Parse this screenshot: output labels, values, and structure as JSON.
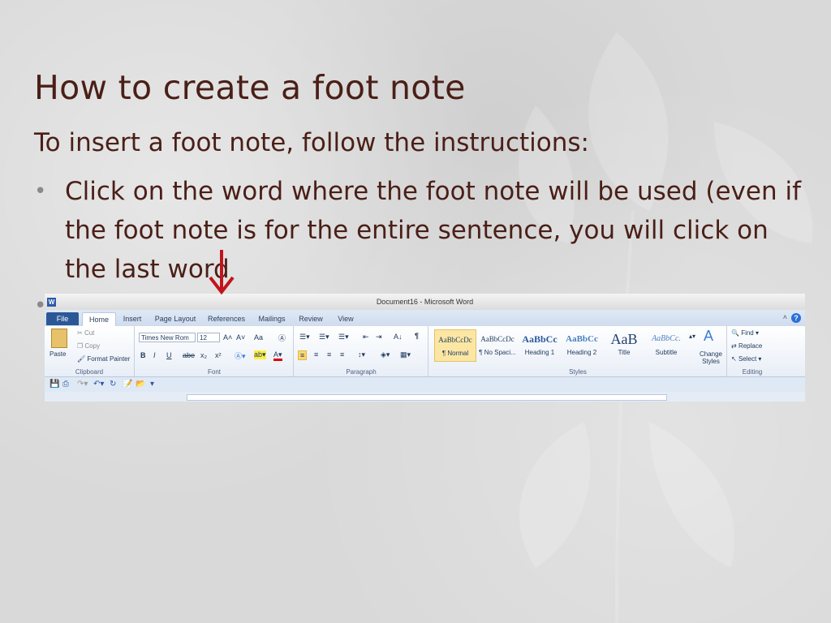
{
  "slide": {
    "title": "How to create a foot note",
    "intro": "To insert a foot note, follow the instructions:",
    "bullet1": "Click on the word where the foot note will be used (even if the foot note is for the entire sentence, you will click on the last word",
    "bullet_marker": "•"
  },
  "word": {
    "window_title": "Document16 - Microsoft Word",
    "app_icon": "W",
    "tabs": [
      "File",
      "Home",
      "Insert",
      "Page Layout",
      "References",
      "Mailings",
      "Review",
      "View"
    ],
    "help": "?",
    "clipboard": {
      "paste": "Paste",
      "cut": "Cut",
      "copy": "Copy",
      "format_painter": "Format Painter",
      "label": "Clipboard"
    },
    "font": {
      "name": "Times New Rom",
      "size": "12",
      "label": "Font",
      "bold": "B",
      "italic": "I",
      "underline": "U",
      "strike": "abe",
      "sub": "x₂",
      "sup": "x²",
      "grow": "A˄",
      "shrink": "A˅",
      "case": "Aa"
    },
    "paragraph": {
      "label": "Paragraph",
      "pilcrow": "¶"
    },
    "styles": {
      "label": "Styles",
      "items": [
        {
          "sample": "AaBbCcDc",
          "name": "¶ Normal"
        },
        {
          "sample": "AaBbCcDc",
          "name": "¶ No Spaci..."
        },
        {
          "sample": "AaBbCc",
          "name": "Heading 1"
        },
        {
          "sample": "AaBbCc",
          "name": "Heading 2"
        },
        {
          "sample": "AaB",
          "name": "Title"
        },
        {
          "sample": "AaBbCc.",
          "name": "Subtitle"
        }
      ],
      "change_styles": "Change Styles"
    },
    "editing": {
      "find": "Find",
      "replace": "Replace",
      "select": "Select",
      "label": "Editing"
    }
  },
  "colors": {
    "title": "#4a1f17",
    "arrow": "#c0151b",
    "accent": "#2b5797"
  }
}
